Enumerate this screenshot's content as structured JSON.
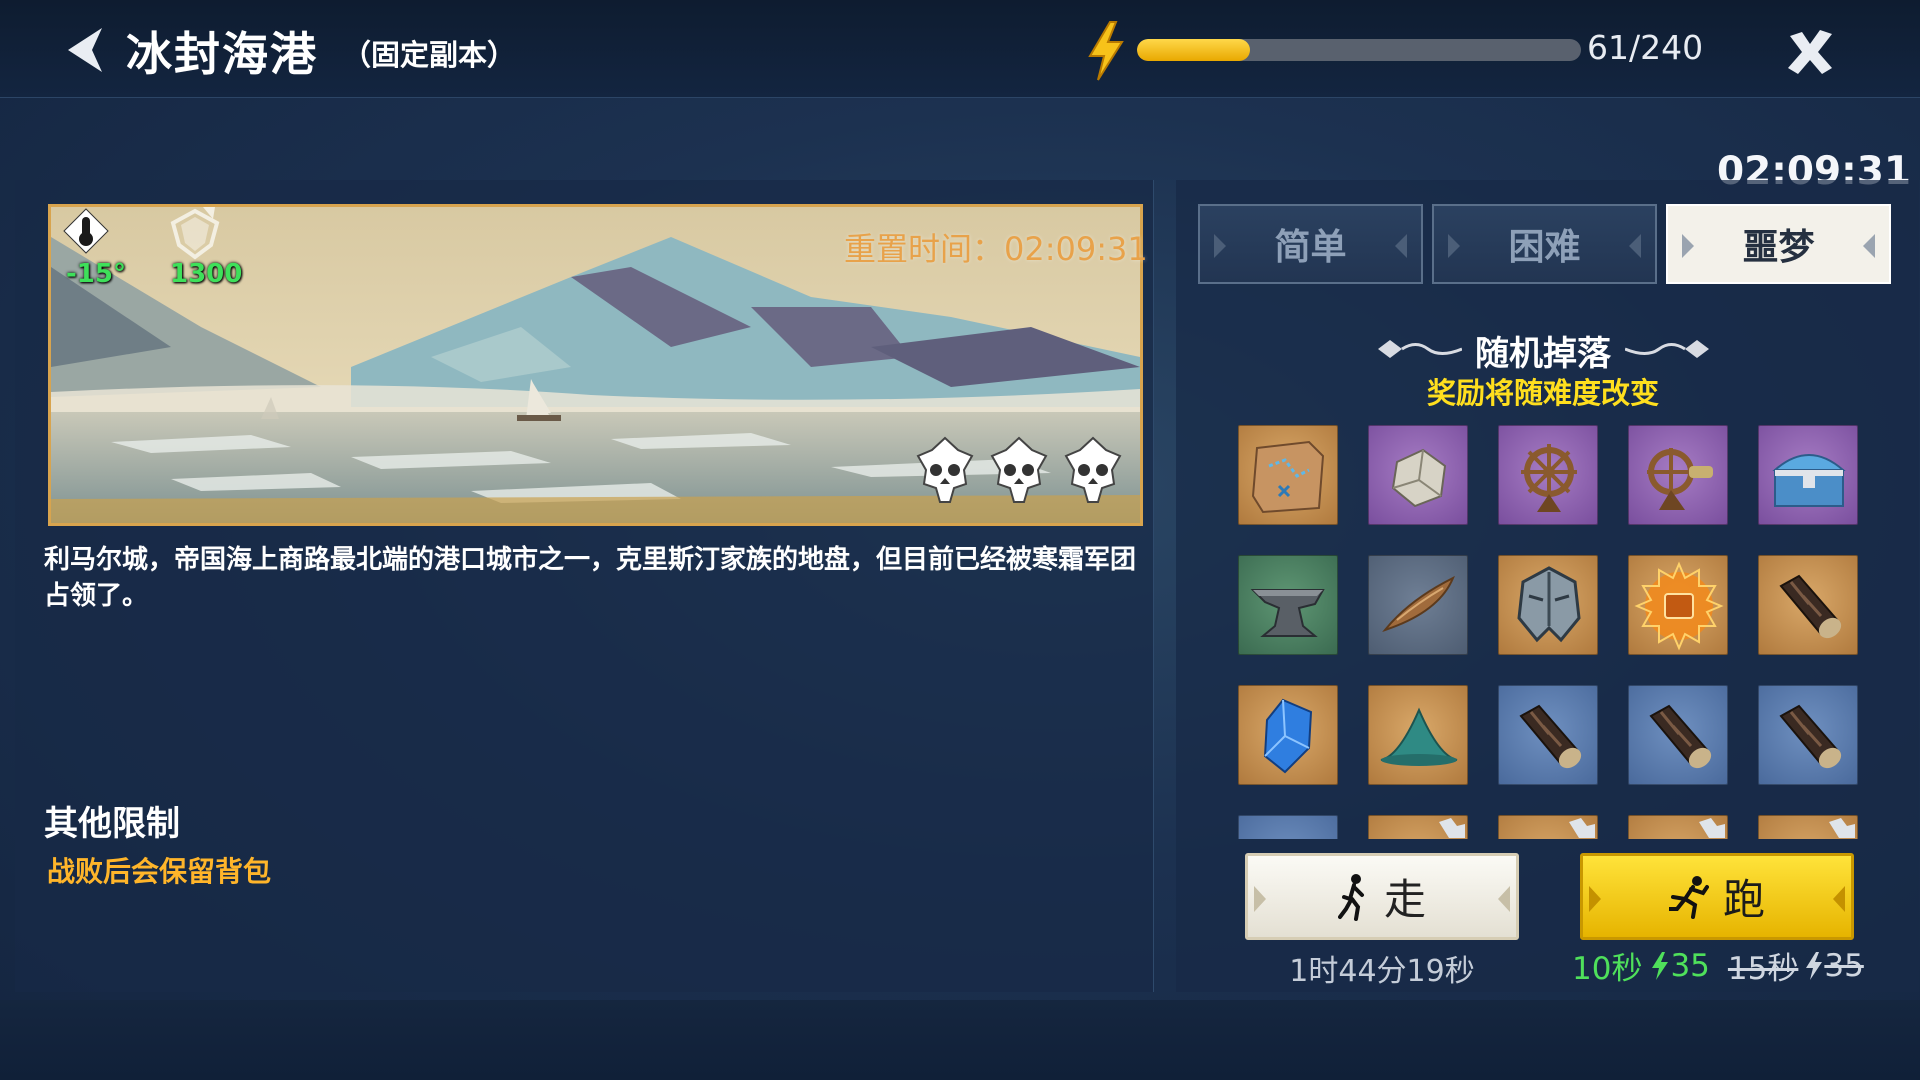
{
  "header": {
    "title": "冰封海港",
    "subtitle": "（固定副本）",
    "energy": {
      "current": 61,
      "max": 240,
      "label": "61/240"
    }
  },
  "timer": "02:09:31",
  "banner": {
    "temperature": "-15°",
    "defense": "1300",
    "reset_label": "重置时间：02:09:31",
    "skull_count": 3
  },
  "description": "利马尔城，帝国海上商路最北端的港口城市之一，克里斯汀家族的地盘，但目前已经被寒霜军团占领了。",
  "restrictions": {
    "title": "其他限制",
    "text": "战败后会保留背包"
  },
  "tabs": [
    {
      "label": "简单",
      "active": false
    },
    {
      "label": "困难",
      "active": false
    },
    {
      "label": "噩梦",
      "active": true
    }
  ],
  "drops": {
    "title": "随机掉落",
    "subtitle": "奖励将随难度改变",
    "items": [
      {
        "icon": "treasure-map-icon",
        "rarity": "orange"
      },
      {
        "icon": "ore-chunk-icon",
        "rarity": "purple"
      },
      {
        "icon": "ship-wheel-icon",
        "rarity": "orange-on-purple"
      },
      {
        "icon": "ship-wheel-crank-icon",
        "rarity": "purple"
      },
      {
        "icon": "treasure-chest-icon",
        "rarity": "purple"
      },
      {
        "icon": "anvil-icon",
        "rarity": "green"
      },
      {
        "icon": "canoe-icon",
        "rarity": "grey"
      },
      {
        "icon": "helmet-icon",
        "rarity": "orange"
      },
      {
        "icon": "blueprint-badge-icon",
        "rarity": "orange"
      },
      {
        "icon": "fabric-roll-icon",
        "rarity": "orange"
      },
      {
        "icon": "blue-crystal-icon",
        "rarity": "orange"
      },
      {
        "icon": "sand-pile-icon",
        "rarity": "orange"
      },
      {
        "icon": "fabric-roll-icon",
        "rarity": "blue"
      },
      {
        "icon": "fabric-roll-icon",
        "rarity": "blue"
      },
      {
        "icon": "fabric-roll-icon",
        "rarity": "blue"
      },
      {
        "icon": "item-icon",
        "rarity": "blue"
      },
      {
        "icon": "item-icon",
        "rarity": "orange"
      },
      {
        "icon": "item-icon",
        "rarity": "orange"
      },
      {
        "icon": "item-icon",
        "rarity": "orange"
      },
      {
        "icon": "item-icon",
        "rarity": "orange"
      }
    ]
  },
  "walk": {
    "label": "走",
    "time": "1时44分19秒"
  },
  "run": {
    "label": "跑",
    "time": "10秒",
    "cost": "35",
    "old_time": "15秒",
    "old_cost": "35"
  },
  "colors": {
    "energy_fill": "#f2c21b",
    "accent_yellow": "#ffdf1e",
    "warning_orange": "#ffb52a",
    "positive_green": "#4fe05b",
    "reset_orange": "#e8a24a"
  }
}
